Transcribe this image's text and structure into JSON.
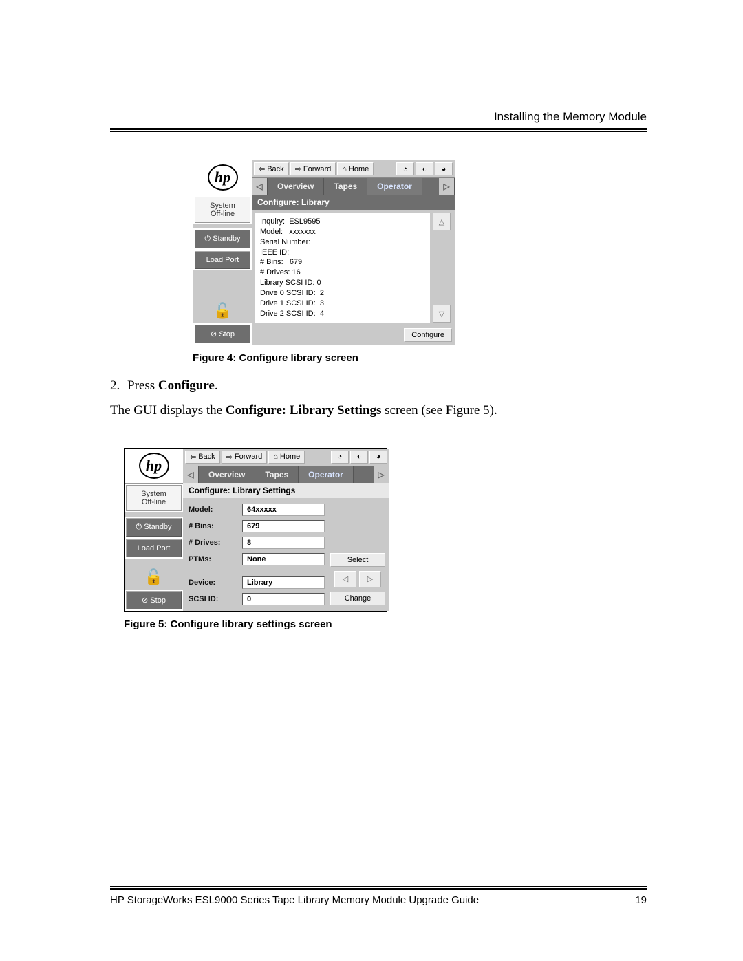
{
  "header": {
    "section_title": "Installing the Memory Module"
  },
  "figure4": {
    "caption_prefix": "Figure 4:  ",
    "caption_title": "Configure library screen",
    "toolbar": {
      "back": "Back",
      "forward": "Forward",
      "home": "Home"
    },
    "tabs": {
      "overview": "Overview",
      "tapes": "Tapes",
      "operator": "Operator"
    },
    "sidebar": {
      "status": "System\nOff-line",
      "standby": "Standby",
      "loadport": "Load Port",
      "stop": "Stop"
    },
    "section_title": "Configure: Library",
    "details": {
      "inquiry_label": "Inquiry:",
      "inquiry_value": "ESL9595",
      "model_label": "Model:",
      "model_value": "xxxxxxx",
      "serial_label": "Serial Number:",
      "ieee_label": "IEEE ID:",
      "bins_label": "# Bins:",
      "bins_value": "679",
      "drives_label": "# Drives:",
      "drives_value": "16",
      "lib_scsi_label": "Library SCSI ID:",
      "lib_scsi_value": "0",
      "d0_label": "Drive 0 SCSI ID:",
      "d0_value": "2",
      "d1_label": "Drive 1 SCSI ID:",
      "d1_value": "3",
      "d2_label": "Drive 2 SCSI ID:",
      "d2_value": "4"
    },
    "configure_btn": "Configure"
  },
  "instructions": {
    "step2_num": "2.",
    "step2_text_a": "Press ",
    "step2_text_b": "Configure",
    "step2_text_c": ".",
    "line2_a": "The GUI displays the ",
    "line2_b": "Configure: Library Settings",
    "line2_c": " screen (see Figure 5)."
  },
  "figure5": {
    "caption_prefix": "Figure 5:  ",
    "caption_title": "Configure library settings screen",
    "toolbar": {
      "back": "Back",
      "forward": "Forward",
      "home": "Home"
    },
    "tabs": {
      "overview": "Overview",
      "tapes": "Tapes",
      "operator": "Operator"
    },
    "sidebar": {
      "status": "System\nOff-line",
      "standby": "Standby",
      "loadport": "Load Port",
      "stop": "Stop"
    },
    "section_title": "Configure: Library Settings",
    "fields": {
      "model_label": "Model:",
      "model_value": "64xxxxx",
      "bins_label": "# Bins:",
      "bins_value": "679",
      "drives_label": "# Drives:",
      "drives_value": "8",
      "ptms_label": "PTMs:",
      "ptms_value": "None",
      "device_label": "Device:",
      "device_value": "Library",
      "scsi_label": "SCSI ID:",
      "scsi_value": "0"
    },
    "buttons": {
      "select": "Select",
      "change": "Change"
    }
  },
  "footer": {
    "doc_title": "HP StorageWorks ESL9000 Series Tape Library Memory Module Upgrade Guide",
    "page_number": "19"
  }
}
